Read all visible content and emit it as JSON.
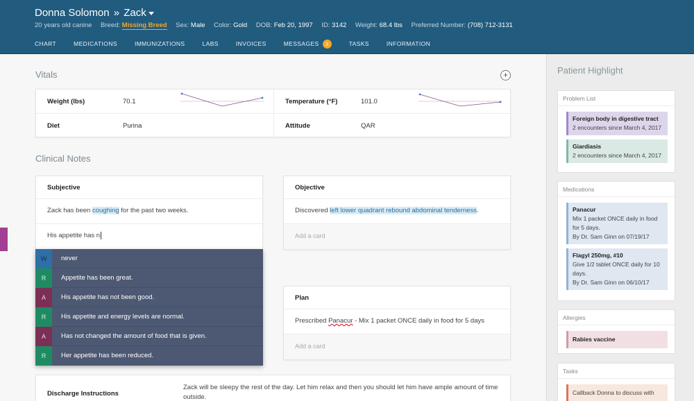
{
  "patient": {
    "owner": "Donna Solomon",
    "separator": "»",
    "pet": "Zack",
    "summary": "20 years old canine",
    "breed_label": "Breed:",
    "breed": "Missing Breed",
    "sex_label": "Sex:",
    "sex": "Male",
    "color_label": "Color:",
    "color": "Gold",
    "dob_label": "DOB:",
    "dob": "Feb 20, 1997",
    "id_label": "ID:",
    "id": "3142",
    "weight_label": "Weight:",
    "weight": "68.4 lbs",
    "phone_label": "Preferred Number:",
    "phone": "(708) 712-3131"
  },
  "tabs": [
    {
      "label": "Chart"
    },
    {
      "label": "Medications"
    },
    {
      "label": "Immunizations"
    },
    {
      "label": "Labs"
    },
    {
      "label": "Invoices"
    },
    {
      "label": "Messages",
      "badge": "3"
    },
    {
      "label": "Tasks"
    },
    {
      "label": "Information"
    }
  ],
  "vitals": {
    "title": "Vitals",
    "add_icon": "+",
    "rows": [
      {
        "label1": "Weight (lbs)",
        "value1": "70.1",
        "label2": "Temperature (°F)",
        "value2": "101.0"
      },
      {
        "label1": "Diet",
        "value1": "Purina",
        "label2": "Attitude",
        "value2": "QAR"
      }
    ]
  },
  "notes": {
    "title": "Clinical Notes",
    "subjective": {
      "title": "Subjective",
      "text_pre": "Zack has been ",
      "text_hl": "coughing",
      "text_post": " for the past two weeks.",
      "input_value": "His appetite has n"
    },
    "objective": {
      "title": "Objective",
      "text_pre": "Discovered ",
      "text_hl": "left lower quadrant rebound abdominal tenderness",
      "text_post": ".",
      "add_card": "Add a card"
    },
    "plan": {
      "title": "Plan",
      "text_pre": "Prescribed ",
      "text_drug": "Panacur",
      "text_post": " - Mix 1 packet ONCE daily in food for 5 days",
      "add_card": "Add a card"
    }
  },
  "suggestions": [
    {
      "tag": "W",
      "kind": "w",
      "text": "never"
    },
    {
      "tag": "R",
      "kind": "r",
      "text": "Appetite has been great."
    },
    {
      "tag": "A",
      "kind": "a",
      "text": "His appetite has not been good."
    },
    {
      "tag": "R",
      "kind": "r",
      "text": "His appetite and energy levels are normal."
    },
    {
      "tag": "A",
      "kind": "a",
      "text": "Has not changed the amount of food that is given."
    },
    {
      "tag": "R",
      "kind": "r",
      "text": "Her appetite has been reduced."
    }
  ],
  "discharge": {
    "title": "Discharge Instructions",
    "text": "Zack will be sleepy the rest of the day. Let him relax and then you should let him have ample amount of time outside."
  },
  "sidebar": {
    "title": "Patient Highlight",
    "problem_list": {
      "title": "Problem List",
      "items": [
        {
          "name": "Foreign body in digestive tract",
          "detail": "2 encounters since March 4, 2017"
        },
        {
          "name": "Giardiasis",
          "detail": "2 encounters since March 4, 2017"
        }
      ]
    },
    "medications": {
      "title": "Medications",
      "items": [
        {
          "name": "Panacur",
          "detail": "Mix 1 packet ONCE daily in food for 5 days.",
          "by": "By Dr. Sam Ginn on 07/19/17"
        },
        {
          "name": "Flagyl 250mg, #10",
          "detail": "Give 1/2 tablet ONCE daily for 10 days.",
          "by": "By Dr. Sam Ginn on 06/10/17"
        }
      ]
    },
    "allergies": {
      "title": "Allergies",
      "items": [
        {
          "name": "Rabies vaccine"
        }
      ]
    },
    "tasks": {
      "title": "Tasks",
      "items": [
        {
          "text": "Callback Donna to discuss with"
        }
      ]
    }
  },
  "colors": {
    "header": "#215b7e",
    "badge": "#f5a623",
    "dropdown": "#4d5873"
  }
}
